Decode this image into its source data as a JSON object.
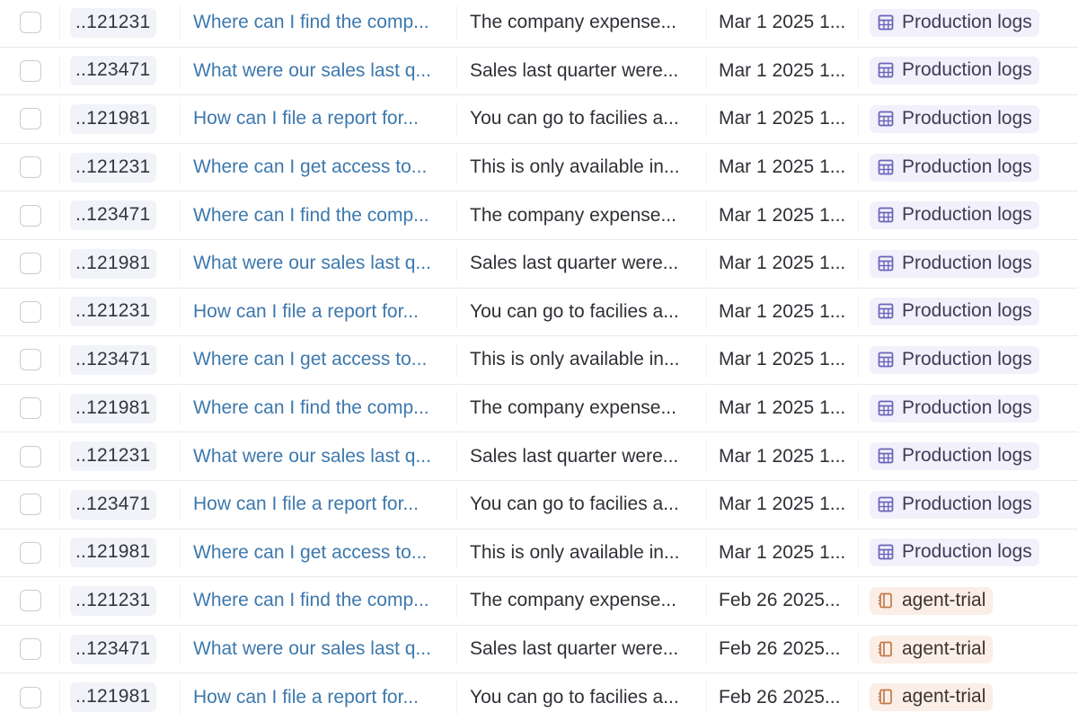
{
  "table": {
    "rows": [
      {
        "id": "..121231",
        "question": "Where can I find the comp...",
        "answer": "The company expense...",
        "date": "Mar 1 2025 1...",
        "tag": "Production logs",
        "tag_icon": "table-icon",
        "tag_kind": "dataset"
      },
      {
        "id": "..123471",
        "question": "What were our sales last q...",
        "answer": "Sales last quarter were...",
        "date": "Mar 1 2025 1...",
        "tag": "Production logs",
        "tag_icon": "table-icon",
        "tag_kind": "dataset"
      },
      {
        "id": "..121981",
        "question": "How can I file a report for...",
        "answer": "You can go to facilies a...",
        "date": "Mar 1 2025 1...",
        "tag": "Production logs",
        "tag_icon": "table-icon",
        "tag_kind": "dataset"
      },
      {
        "id": "..121231",
        "question": "Where can I get access to...",
        "answer": "This is only available in...",
        "date": "Mar 1 2025 1...",
        "tag": "Production logs",
        "tag_icon": "table-icon",
        "tag_kind": "dataset"
      },
      {
        "id": "..123471",
        "question": "Where can I find the comp...",
        "answer": "The company expense...",
        "date": "Mar 1 2025 1...",
        "tag": "Production logs",
        "tag_icon": "table-icon",
        "tag_kind": "dataset"
      },
      {
        "id": "..121981",
        "question": "What were our sales last q...",
        "answer": "Sales last quarter were...",
        "date": "Mar 1 2025 1...",
        "tag": "Production logs",
        "tag_icon": "table-icon",
        "tag_kind": "dataset"
      },
      {
        "id": "..121231",
        "question": "How can I file a report for...",
        "answer": "You can go to facilies a...",
        "date": "Mar 1 2025 1...",
        "tag": "Production logs",
        "tag_icon": "table-icon",
        "tag_kind": "dataset"
      },
      {
        "id": "..123471",
        "question": "Where can I get access to...",
        "answer": "This is only available in...",
        "date": "Mar 1 2025 1...",
        "tag": "Production logs",
        "tag_icon": "table-icon",
        "tag_kind": "dataset"
      },
      {
        "id": "..121981",
        "question": "Where can I find the comp...",
        "answer": "The company expense...",
        "date": "Mar 1 2025 1...",
        "tag": "Production logs",
        "tag_icon": "table-icon",
        "tag_kind": "dataset"
      },
      {
        "id": "..121231",
        "question": "What were our sales last q...",
        "answer": "Sales last quarter were...",
        "date": "Mar 1 2025 1...",
        "tag": "Production logs",
        "tag_icon": "table-icon",
        "tag_kind": "dataset"
      },
      {
        "id": "..123471",
        "question": "How can I file a report for...",
        "answer": "You can go to facilies a...",
        "date": "Mar 1 2025 1...",
        "tag": "Production logs",
        "tag_icon": "table-icon",
        "tag_kind": "dataset"
      },
      {
        "id": "..121981",
        "question": "Where can I get access to...",
        "answer": "This is only available in...",
        "date": "Mar 1 2025 1...",
        "tag": "Production logs",
        "tag_icon": "table-icon",
        "tag_kind": "dataset"
      },
      {
        "id": "..121231",
        "question": "Where can I find the comp...",
        "answer": "The company expense...",
        "date": "Feb 26 2025...",
        "tag": "agent-trial",
        "tag_icon": "experiment-icon",
        "tag_kind": "experiment"
      },
      {
        "id": "..123471",
        "question": "What were our sales last q...",
        "answer": "Sales last quarter were...",
        "date": "Feb 26 2025...",
        "tag": "agent-trial",
        "tag_icon": "experiment-icon",
        "tag_kind": "experiment"
      },
      {
        "id": "..121981",
        "question": "How can I file a report for...",
        "answer": "You can go to facilies a...",
        "date": "Feb 26 2025...",
        "tag": "agent-trial",
        "tag_icon": "experiment-icon",
        "tag_kind": "experiment"
      }
    ]
  },
  "colors": {
    "link_blue": "#3d78ad",
    "dataset_tag_bg": "#f1f0fb",
    "dataset_icon": "#6a63b8",
    "experiment_tag_bg": "#fbeee6",
    "experiment_icon": "#c27a4a",
    "row_border": "#e8e9ee",
    "id_pill_bg": "#f1f3f8"
  }
}
